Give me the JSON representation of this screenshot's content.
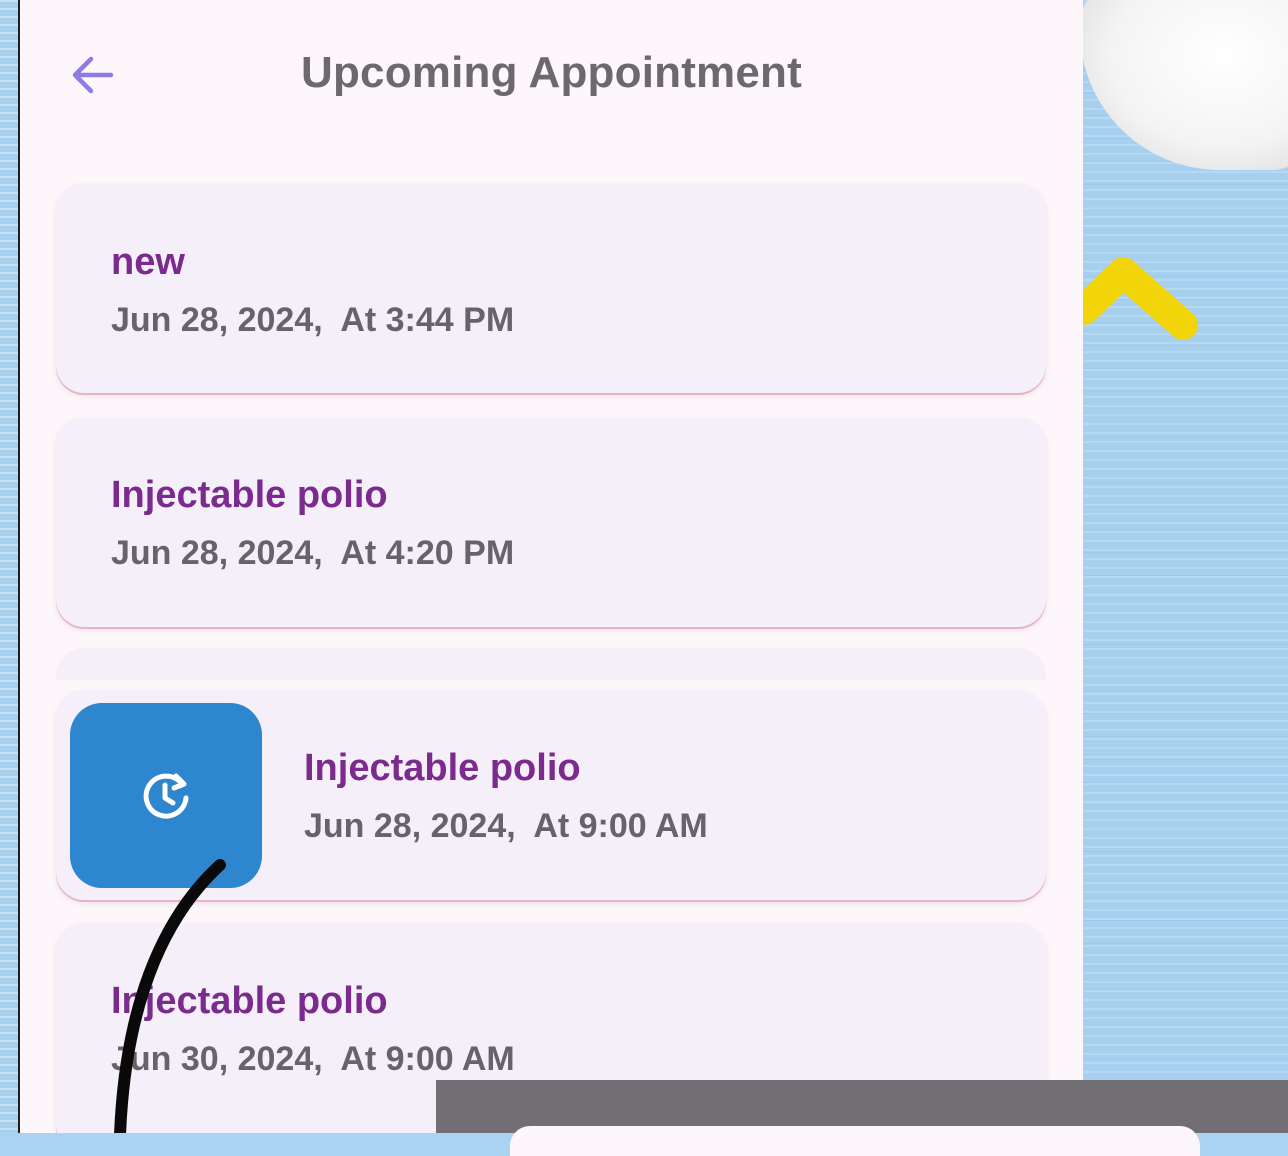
{
  "header": {
    "title": "Upcoming Appointment",
    "back_icon": "arrow-left-icon"
  },
  "appointments": [
    {
      "title": "new",
      "date": "Jun 28, 2024,  At 3:44 PM"
    },
    {
      "title": "Injectable polio",
      "date": "Jun 28, 2024,  At 4:20 PM"
    },
    {
      "title": "Injectable polio",
      "date": "Jun 28, 2024,  At 9:00 AM"
    },
    {
      "title": "Injectable polio",
      "date": "Jun 30, 2024,  At 9:00 AM"
    }
  ],
  "swipe_action": {
    "icon": "reschedule-clock-icon"
  },
  "colors": {
    "title_accent": "#7b2a8d",
    "date_text": "#666468",
    "card_bg": "#f4eff8",
    "action_blue": "#2e86cf",
    "back_arrow": "#8f7be6"
  }
}
